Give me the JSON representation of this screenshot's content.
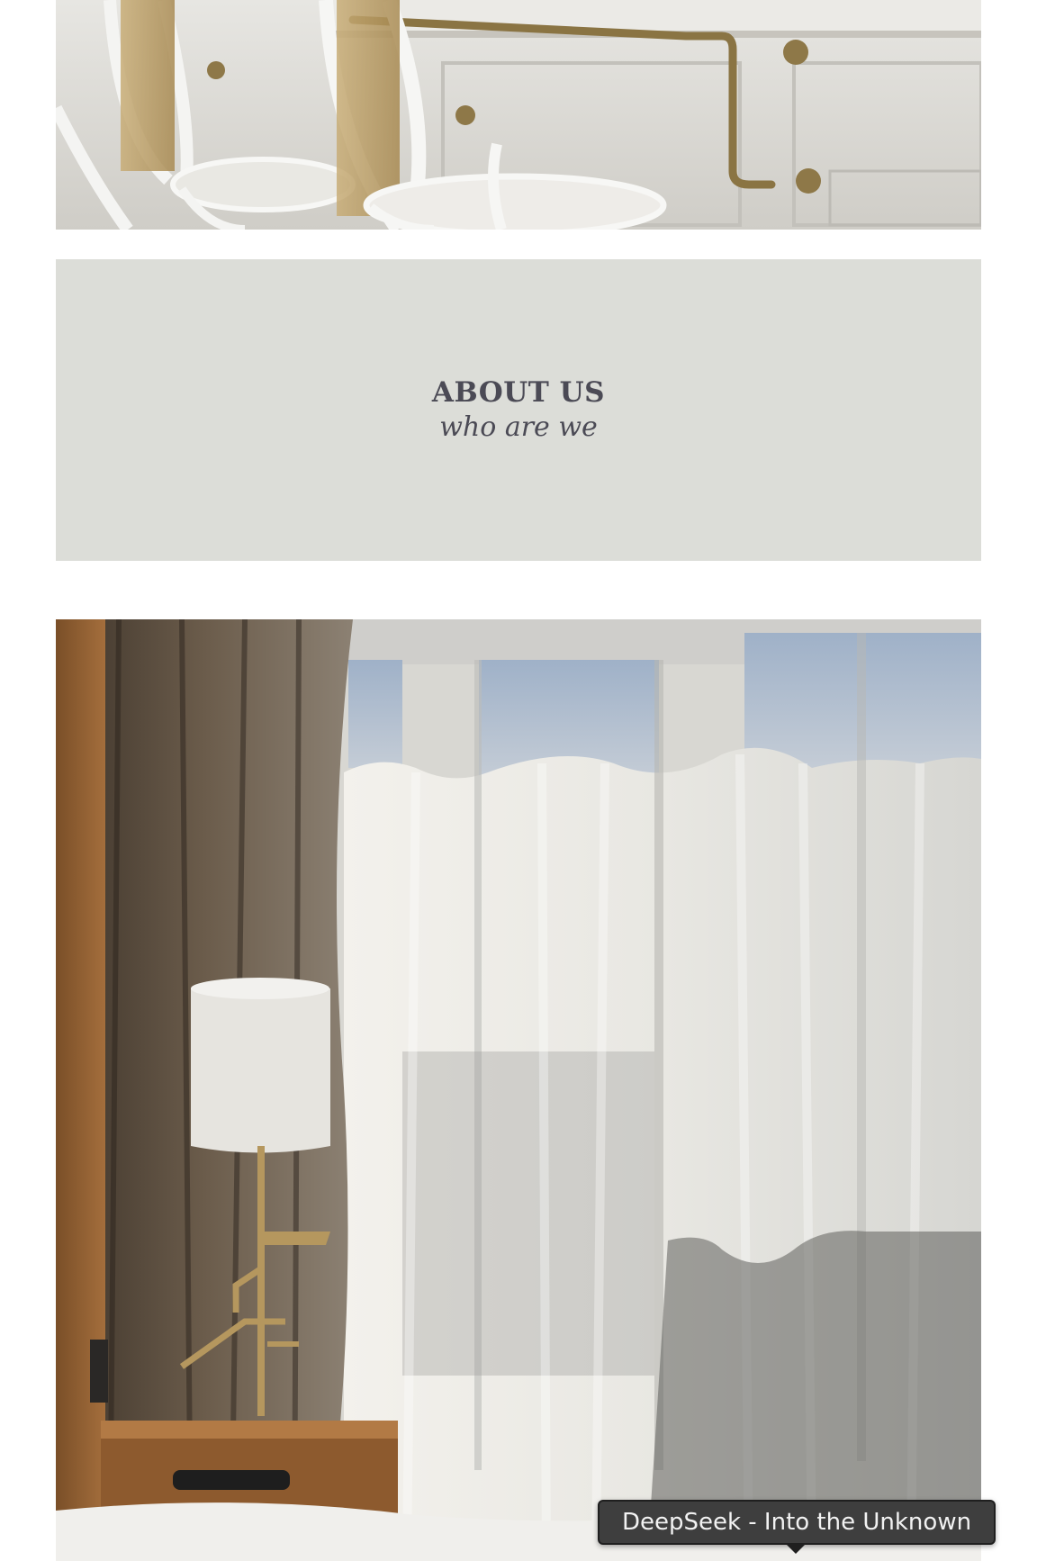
{
  "about": {
    "title": "ABOUT US",
    "subtitle": "who are we"
  },
  "tooltip": {
    "text": "DeepSeek - Into the Unknown"
  },
  "colors": {
    "panel_background": "#dcddd8",
    "heading_text": "#4b4a55",
    "tooltip_background": "#3e3e3e",
    "page_background": "#ffffff"
  }
}
